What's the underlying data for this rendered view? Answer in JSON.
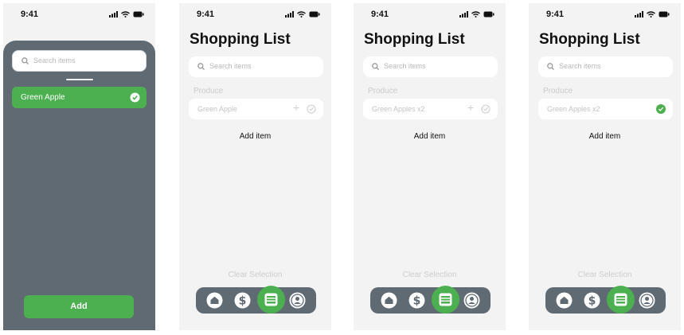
{
  "status": {
    "time": "9:41"
  },
  "screen1": {
    "search_placeholder": "Search items",
    "selected_item": "Green Apple",
    "add_button": "Add"
  },
  "screen2": {
    "title": "Shopping List",
    "search_placeholder": "Search items",
    "section": "Produce",
    "item": "Green Apple",
    "add_item": "Add item",
    "clear": "Clear Selection"
  },
  "screen3": {
    "title": "Shopping List",
    "search_placeholder": "Search items",
    "section": "Produce",
    "item": "Green Apples x2",
    "add_item": "Add item",
    "clear": "Clear Selection"
  },
  "screen4": {
    "title": "Shopping List",
    "search_placeholder": "Search items",
    "section": "Produce",
    "item": "Green Apples x2",
    "add_item": "Add item",
    "clear": "Clear Selection"
  },
  "colors": {
    "accent": "#4caf50",
    "dark": "#5f6a73",
    "background": "#f3f3f3"
  },
  "tabbar_icons": [
    "home-icon",
    "dollar-icon",
    "list-icon",
    "profile-icon"
  ]
}
